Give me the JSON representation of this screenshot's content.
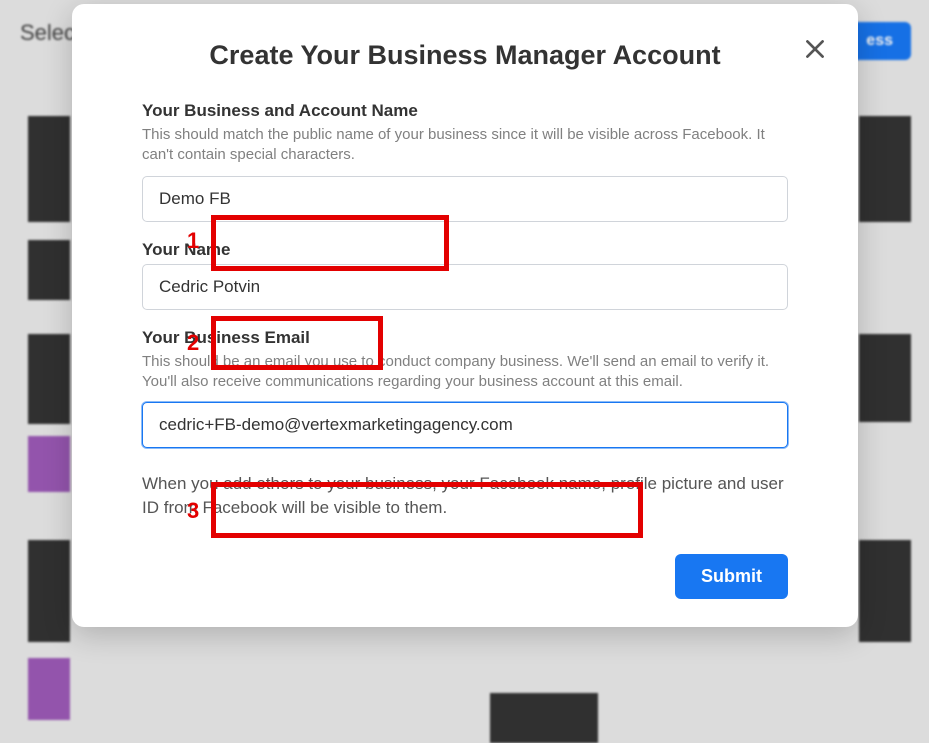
{
  "bg": {
    "header": "Select",
    "button": "ess"
  },
  "modal": {
    "title": "Create Your Business Manager Account",
    "fields": {
      "business": {
        "label": "Your Business and Account Name",
        "desc": "This should match the public name of your business since it will be visible across Facebook. It can't contain special characters.",
        "value": "Demo FB"
      },
      "name": {
        "label": "Your Name",
        "value": "Cedric Potvin"
      },
      "email": {
        "label": "Your Business Email",
        "desc": "This should be an email you use to conduct company business. We'll send an email to verify it. You'll also receive communications regarding your business account at this email.",
        "value": "cedric+FB-demo@vertexmarketingagency.com"
      }
    },
    "note": "When you add others to your business, your Facebook name, profile picture and user ID from Facebook will be visible to them.",
    "submit": "Submit"
  },
  "annotations": {
    "n1": "1",
    "n2": "2",
    "n3": "3"
  }
}
